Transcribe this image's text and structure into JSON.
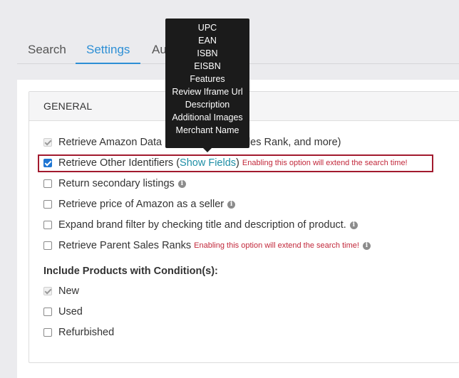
{
  "tabs": [
    {
      "label": "Search"
    },
    {
      "label": "Settings"
    },
    {
      "label": "Auto Se"
    }
  ],
  "section": {
    "title": "GENERAL"
  },
  "options": {
    "retrieve_amazon": {
      "label": "Retrieve Amazon Data (ASIN, Pricing, Sales Rank, and more)",
      "checked": true,
      "disabled": true
    },
    "retrieve_ids": {
      "label_prefix": "Retrieve Other Identifiers (",
      "link": "Show Fields",
      "label_suffix": ")",
      "warning": "Enabling this option will extend the search time!",
      "checked": true
    },
    "secondary": {
      "label": "Return secondary listings",
      "checked": false
    },
    "price_seller": {
      "label": "Retrieve price of Amazon as a seller",
      "checked": false
    },
    "brand_filter": {
      "label": "Expand brand filter by checking title and description of product.",
      "checked": false
    },
    "parent_rank": {
      "label": "Retrieve Parent Sales Ranks",
      "warning": "Enabling this option will extend the search time!",
      "checked": false
    }
  },
  "conditions": {
    "title": "Include Products with Condition(s):",
    "items": [
      {
        "label": "New",
        "checked": true,
        "disabled": true
      },
      {
        "label": "Used",
        "checked": false
      },
      {
        "label": "Refurbished",
        "checked": false
      }
    ]
  },
  "tooltip": {
    "fields": [
      "UPC",
      "EAN",
      "ISBN",
      "EISBN",
      "Features",
      "Review Iframe Url",
      "Description",
      "Additional Images",
      "Merchant Name"
    ]
  },
  "icons": {
    "info": "info-circle-icon"
  },
  "colors": {
    "accent": "#2d8fd5",
    "warning": "#c2283b",
    "highlight": "#a21a2e",
    "link": "#1f8fa6"
  }
}
